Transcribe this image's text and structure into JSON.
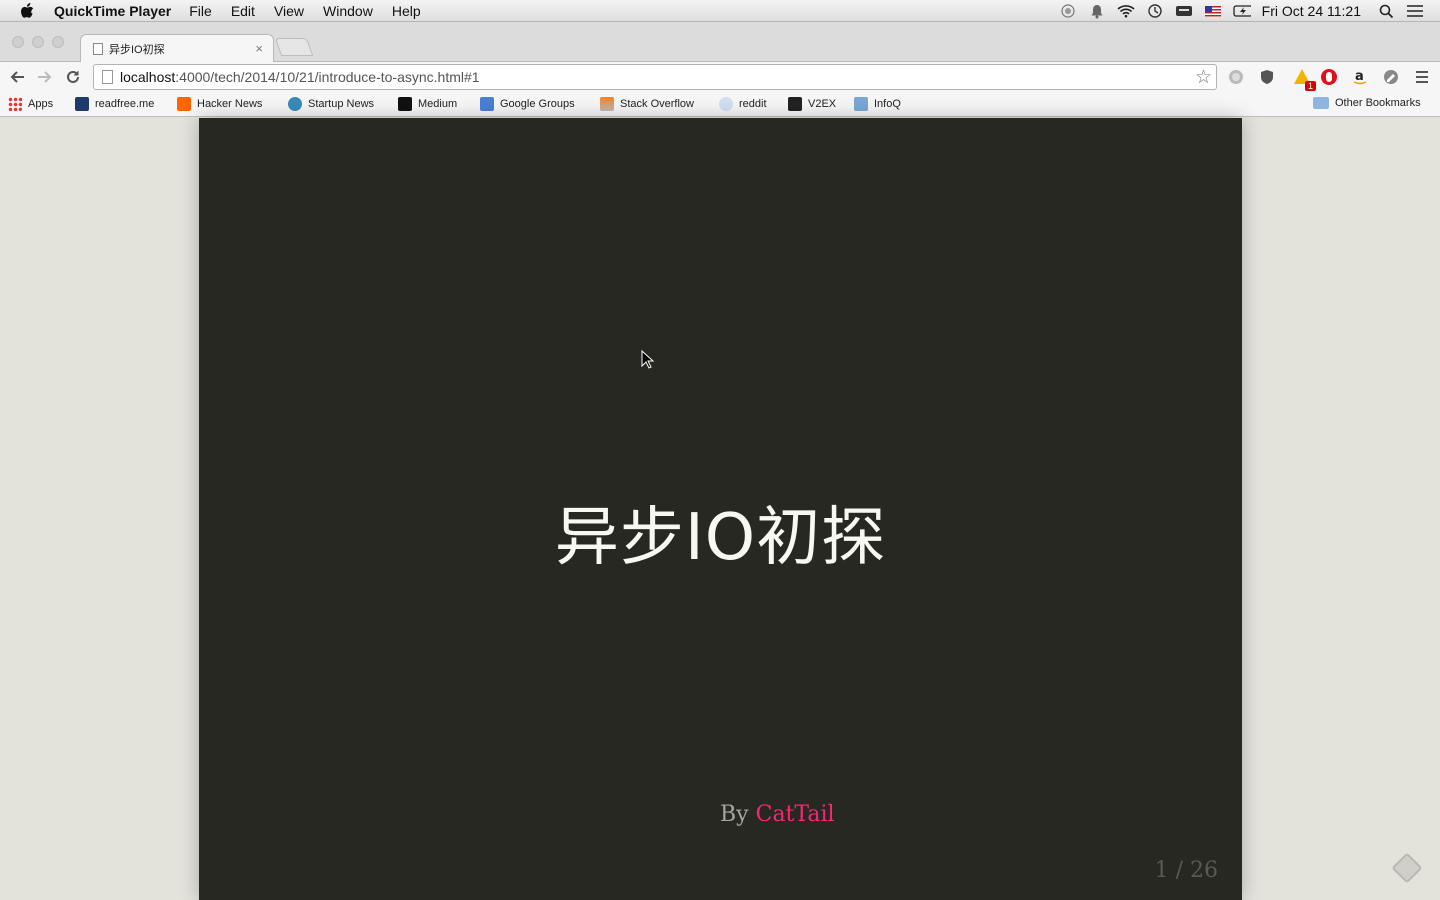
{
  "menubar": {
    "app_name": "QuickTime Player",
    "items": [
      "File",
      "Edit",
      "View",
      "Window",
      "Help"
    ],
    "clock": "Fri Oct 24  11:21"
  },
  "tab": {
    "title": "异步IO初探"
  },
  "omnibox": {
    "host": "localhost",
    "path": ":4000/tech/2014/10/21/introduce-to-async.html#1"
  },
  "extensions": {
    "badge": "1"
  },
  "bookmarks": {
    "items": [
      "Apps",
      "readfree.me",
      "Hacker News",
      "Startup News",
      "Medium",
      "Google Groups",
      "Stack Overflow",
      "reddit",
      "V2EX",
      "InfoQ"
    ],
    "other": "Other Bookmarks"
  },
  "slide": {
    "title": "异步IO初探",
    "by": "By",
    "author": "CatTail",
    "counter": "1 / 26"
  }
}
